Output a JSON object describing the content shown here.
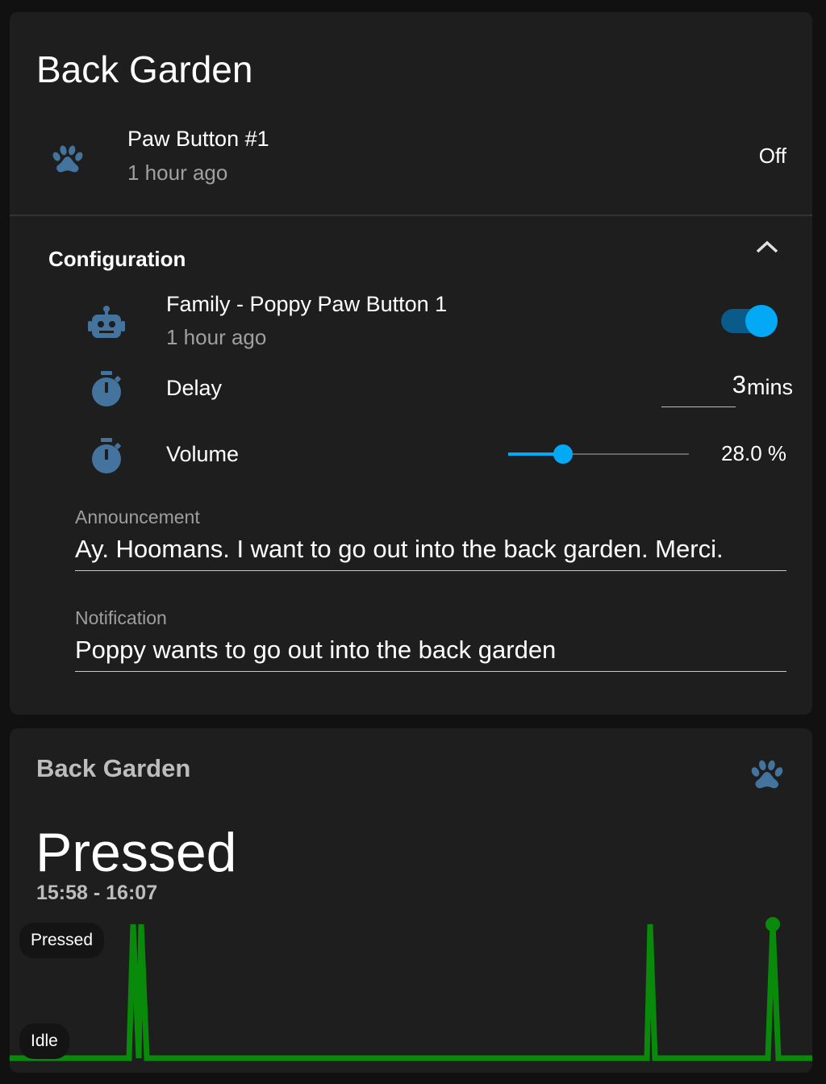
{
  "entities_card": {
    "title": "Back Garden",
    "paw_button": {
      "icon": "paw-icon",
      "name": "Paw Button #1",
      "last_changed": "1 hour ago",
      "state": "Off"
    },
    "configuration": {
      "title": "Configuration",
      "expanded": true,
      "automation": {
        "icon": "robot-icon",
        "name": "Family - Poppy Paw Button 1",
        "last_changed": "1 hour ago",
        "enabled": true
      },
      "delay": {
        "icon": "timer-icon",
        "name": "Delay",
        "value": "3",
        "unit": "mins"
      },
      "volume": {
        "icon": "timer-icon",
        "name": "Volume",
        "value": 28.0,
        "display": "28.0 %"
      },
      "announcement": {
        "label": "Announcement",
        "value": "Ay. Hoomans. I want to go out into the back garden. Merci."
      },
      "notification": {
        "label": "Notification",
        "value": "Poppy wants to go out into the back garden"
      }
    }
  },
  "history_card": {
    "name": "Back Garden",
    "icon": "paw-icon",
    "state": "Pressed",
    "time_range": "15:58 - 16:07",
    "labels": {
      "top": "Pressed",
      "bottom": "Idle"
    },
    "line_color": "#0a8a0a"
  },
  "colors": {
    "accent": "#03a9f4",
    "icon": "#44739e",
    "card_bg": "#1e1e1e"
  }
}
